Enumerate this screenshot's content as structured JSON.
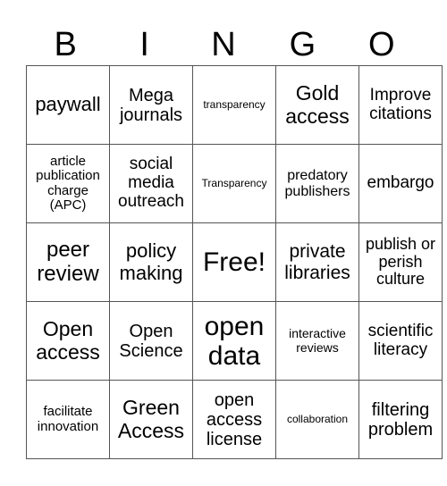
{
  "title_letters": [
    "B",
    "I",
    "N",
    "G",
    "O"
  ],
  "rows": [
    [
      {
        "text": "paywall",
        "size": 22
      },
      {
        "text": "Mega journals",
        "size": 20
      },
      {
        "text": "transparency",
        "size": 12
      },
      {
        "text": "Gold access",
        "size": 23
      },
      {
        "text": "Improve citations",
        "size": 19
      }
    ],
    [
      {
        "text": "article publication charge (APC)",
        "size": 15
      },
      {
        "text": "social media outreach",
        "size": 19
      },
      {
        "text": "Transparency",
        "size": 12
      },
      {
        "text": "predatory publishers",
        "size": 16
      },
      {
        "text": "embargo",
        "size": 19
      }
    ],
    [
      {
        "text": "peer review",
        "size": 24
      },
      {
        "text": "policy making",
        "size": 22
      },
      {
        "text": "Free!",
        "size": 30
      },
      {
        "text": "private libraries",
        "size": 21
      },
      {
        "text": "publish or perish culture",
        "size": 18
      }
    ],
    [
      {
        "text": "Open access",
        "size": 23
      },
      {
        "text": "Open Science",
        "size": 20
      },
      {
        "text": "open data",
        "size": 30
      },
      {
        "text": "interactive reviews",
        "size": 14
      },
      {
        "text": "scientific literacy",
        "size": 19
      }
    ],
    [
      {
        "text": "facilitate innovation",
        "size": 15
      },
      {
        "text": "Green Access",
        "size": 23
      },
      {
        "text": "open access license",
        "size": 20
      },
      {
        "text": "collaboration",
        "size": 12
      },
      {
        "text": "filtering problem",
        "size": 20
      }
    ]
  ]
}
